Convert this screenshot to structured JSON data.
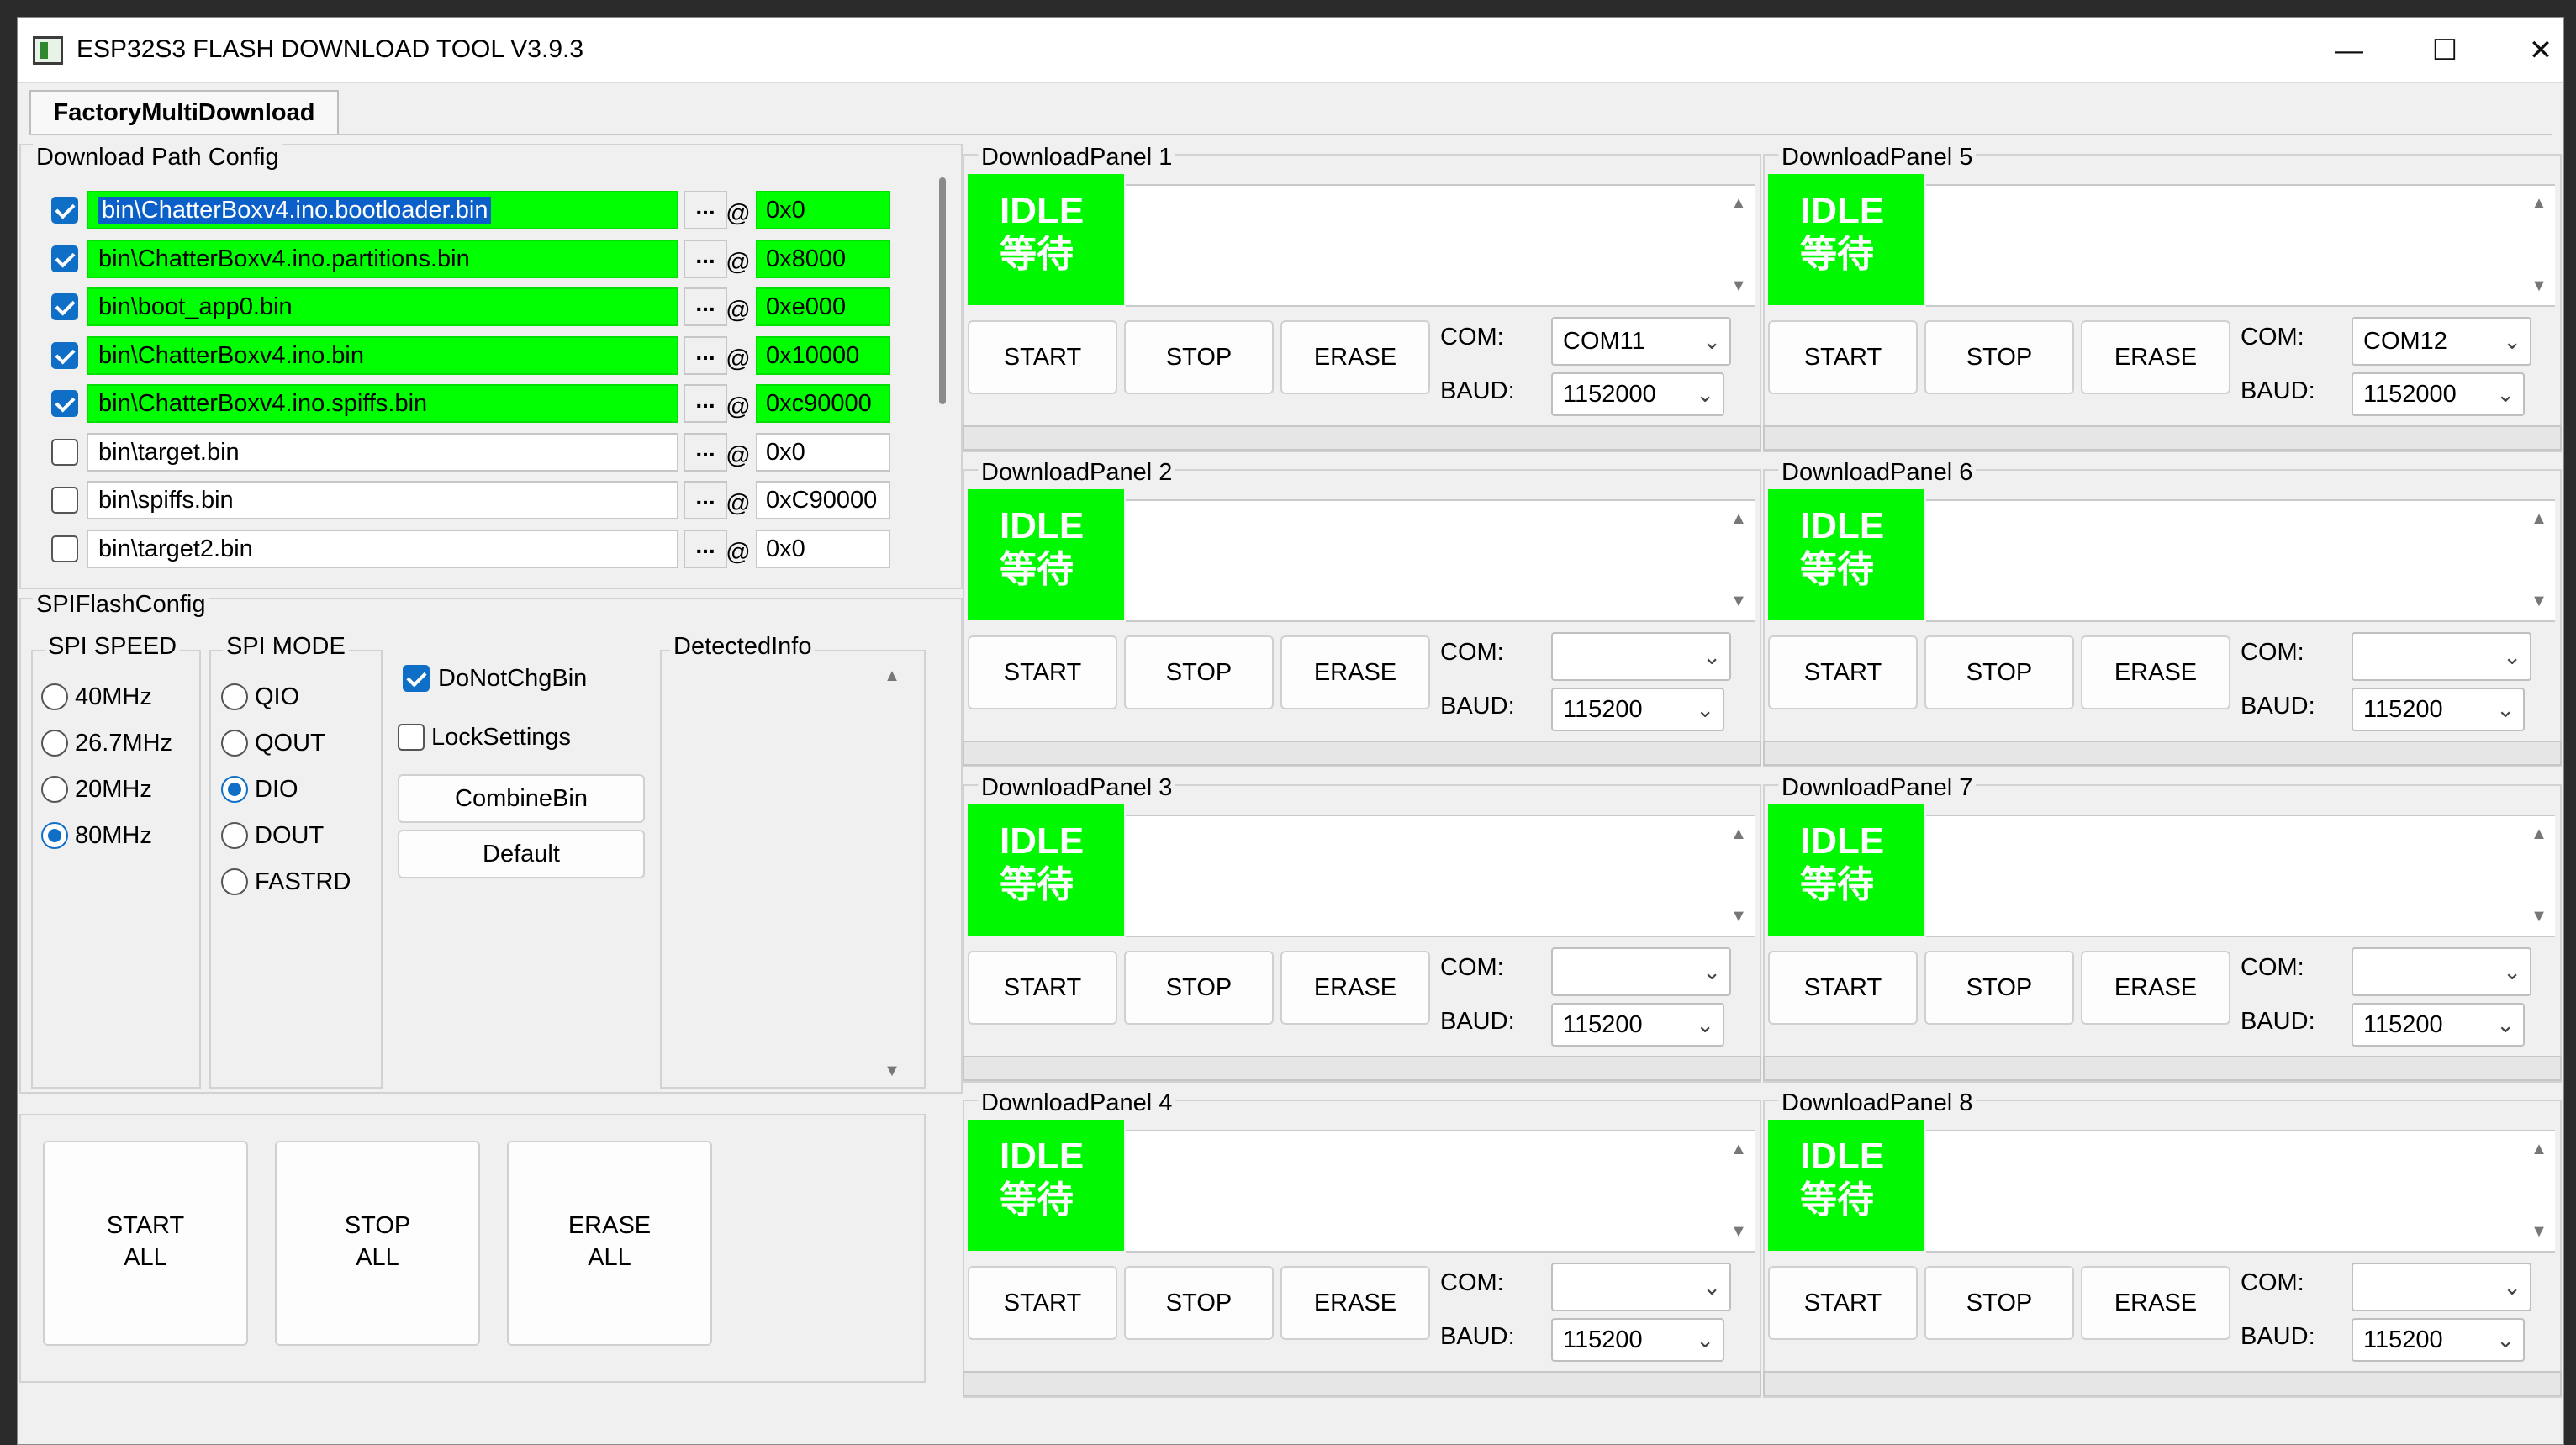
{
  "window": {
    "title": "ESP32S3 FLASH DOWNLOAD TOOL V3.9.3",
    "controls": {
      "minimize": "—",
      "maximize": "☐",
      "close": "✕"
    }
  },
  "tab": {
    "label": "FactoryMultiDownload"
  },
  "download_path_config": {
    "title": "Download Path Config",
    "rows": [
      {
        "checked": true,
        "path": "bin\\ChatterBoxv4.ino.bootloader.bin",
        "browse": "...",
        "at": "@",
        "addr": "0x0"
      },
      {
        "checked": true,
        "path": "bin\\ChatterBoxv4.ino.partitions.bin",
        "browse": "...",
        "at": "@",
        "addr": "0x8000"
      },
      {
        "checked": true,
        "path": "bin\\boot_app0.bin",
        "browse": "...",
        "at": "@",
        "addr": "0xe000"
      },
      {
        "checked": true,
        "path": "bin\\ChatterBoxv4.ino.bin",
        "browse": "...",
        "at": "@",
        "addr": "0x10000"
      },
      {
        "checked": true,
        "path": "bin\\ChatterBoxv4.ino.spiffs.bin",
        "browse": "...",
        "at": "@",
        "addr": "0xc90000"
      },
      {
        "checked": false,
        "path": "bin\\target.bin",
        "browse": "...",
        "at": "@",
        "addr": "0x0"
      },
      {
        "checked": false,
        "path": "bin\\spiffs.bin",
        "browse": "...",
        "at": "@",
        "addr": "0xC90000"
      },
      {
        "checked": false,
        "path": "bin\\target2.bin",
        "browse": "...",
        "at": "@",
        "addr": "0x0"
      }
    ]
  },
  "spi_flash_config": {
    "title": "SPIFlashConfig",
    "speed": {
      "title": "SPI SPEED",
      "options": [
        "40MHz",
        "26.7MHz",
        "20MHz",
        "80MHz"
      ],
      "selected": "80MHz"
    },
    "mode": {
      "title": "SPI MODE",
      "options": [
        "QIO",
        "QOUT",
        "DIO",
        "DOUT",
        "FASTRD"
      ],
      "selected": "DIO"
    },
    "do_not_chg_bin": {
      "label": "DoNotChgBin",
      "checked": true
    },
    "lock_settings": {
      "label": "LockSettings",
      "checked": false
    },
    "combine_bin": "CombineBin",
    "default": "Default",
    "detected_info": {
      "title": "DetectedInfo"
    }
  },
  "global_buttons": {
    "start_all": "START\nALL",
    "stop_all": "STOP\nALL",
    "erase_all": "ERASE\nALL"
  },
  "panels": [
    {
      "title": "DownloadPanel 1",
      "status_en": "IDLE",
      "status_cn": "等待",
      "start": "START",
      "stop": "STOP",
      "erase": "ERASE",
      "com_label": "COM:",
      "com": "COM11",
      "baud_label": "BAUD:",
      "baud": "1152000"
    },
    {
      "title": "DownloadPanel 2",
      "status_en": "IDLE",
      "status_cn": "等待",
      "start": "START",
      "stop": "STOP",
      "erase": "ERASE",
      "com_label": "COM:",
      "com": "",
      "baud_label": "BAUD:",
      "baud": "115200"
    },
    {
      "title": "DownloadPanel 3",
      "status_en": "IDLE",
      "status_cn": "等待",
      "start": "START",
      "stop": "STOP",
      "erase": "ERASE",
      "com_label": "COM:",
      "com": "",
      "baud_label": "BAUD:",
      "baud": "115200"
    },
    {
      "title": "DownloadPanel 4",
      "status_en": "IDLE",
      "status_cn": "等待",
      "start": "START",
      "stop": "STOP",
      "erase": "ERASE",
      "com_label": "COM:",
      "com": "",
      "baud_label": "BAUD:",
      "baud": "115200"
    },
    {
      "title": "DownloadPanel 5",
      "status_en": "IDLE",
      "status_cn": "等待",
      "start": "START",
      "stop": "STOP",
      "erase": "ERASE",
      "com_label": "COM:",
      "com": "COM12",
      "baud_label": "BAUD:",
      "baud": "1152000"
    },
    {
      "title": "DownloadPanel 6",
      "status_en": "IDLE",
      "status_cn": "等待",
      "start": "START",
      "stop": "STOP",
      "erase": "ERASE",
      "com_label": "COM:",
      "com": "",
      "baud_label": "BAUD:",
      "baud": "115200"
    },
    {
      "title": "DownloadPanel 7",
      "status_en": "IDLE",
      "status_cn": "等待",
      "start": "START",
      "stop": "STOP",
      "erase": "ERASE",
      "com_label": "COM:",
      "com": "",
      "baud_label": "BAUD:",
      "baud": "115200"
    },
    {
      "title": "DownloadPanel 8",
      "status_en": "IDLE",
      "status_cn": "等待",
      "start": "START",
      "stop": "STOP",
      "erase": "ERASE",
      "com_label": "COM:",
      "com": "",
      "baud_label": "BAUD:",
      "baud": "115200"
    }
  ],
  "colors": {
    "idle_green": "#00f800",
    "path_green": "#00ff00",
    "accent_blue": "#0f6fc6"
  }
}
